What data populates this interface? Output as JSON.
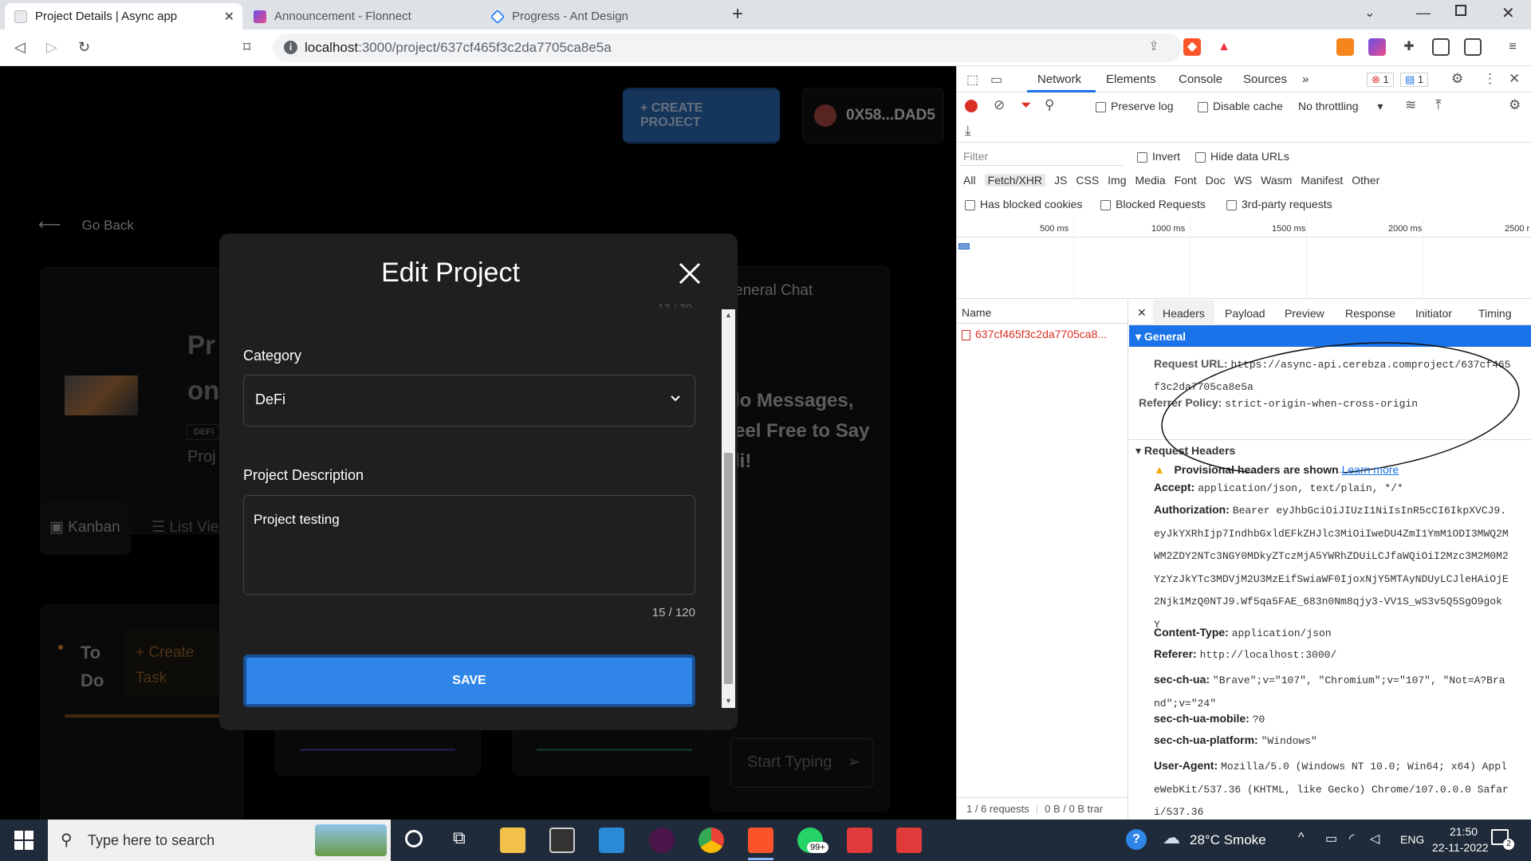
{
  "browser": {
    "tabs": [
      {
        "title": "Project Details | Async app"
      },
      {
        "title": "Announcement - Flonnect"
      },
      {
        "title": "Progress - Ant Design"
      }
    ],
    "url_host": "localhost",
    "url_path": ":3000/project/637cf465f3c2da7705ca8e5a"
  },
  "app": {
    "create_project": "+ CREATE PROJECT",
    "wallet": "0X58...DAD5",
    "go_back": "Go Back",
    "project_title_frag1": "Pr",
    "project_title_frag2": "on",
    "badge": "DEFI",
    "project_frag3": "Proj",
    "general_chat": "eneral Chat",
    "no_messages": "lo Messages,\neel Free to Say\nli!",
    "kanban": "Kanban",
    "list_view": "List Vie",
    "todo": "To\nDo",
    "create_task": "+ Create\nTask",
    "chat_placeholder": "Start Typing"
  },
  "modal": {
    "title": "Edit Project",
    "partial_counter": "13 / 30",
    "category_label": "Category",
    "category_value": "DeFi",
    "description_label": "Project Description",
    "description_value": "Project testing",
    "counter": "15 / 120",
    "save": "SAVE"
  },
  "devtools": {
    "tabs": [
      "Network",
      "Elements",
      "Console",
      "Sources"
    ],
    "error_count": "1",
    "message_count": "1",
    "preserve_log": "Preserve log",
    "disable_cache": "Disable cache",
    "throttling": "No throttling",
    "filter_placeholder": "Filter",
    "invert": "Invert",
    "hide_data_urls": "Hide data URLs",
    "type_filters": [
      "All",
      "Fetch/XHR",
      "JS",
      "CSS",
      "Img",
      "Media",
      "Font",
      "Doc",
      "WS",
      "Wasm",
      "Manifest",
      "Other"
    ],
    "has_blocked_cookies": "Has blocked cookies",
    "blocked_requests": "Blocked Requests",
    "third_party": "3rd-party requests",
    "timeline_ticks": [
      "500 ms",
      "1000 ms",
      "1500 ms",
      "2000 ms",
      "2500 r"
    ],
    "name_header": "Name",
    "request_name": "637cf465f3c2da7705ca8...",
    "detail_tabs": [
      "Headers",
      "Payload",
      "Preview",
      "Response",
      "Initiator",
      "Timing"
    ],
    "general_title": "General",
    "request_url_label": "Request URL:",
    "request_url_value": "https://async-api.cerebza.comproject/637cf465\nf3c2da7705ca8e5a",
    "referrer_policy_label": "Referrer Policy:",
    "referrer_policy_value": "strict-origin-when-cross-origin",
    "request_headers_title": "Request Headers",
    "provisional": "Provisional headers are shown",
    "learn_more": "Learn more",
    "headers": [
      {
        "k": "Accept:",
        "v": "application/json, text/plain, */*"
      },
      {
        "k": "Authorization:",
        "v": "Bearer eyJhbGciOiJIUzI1NiIsInR5cCI6IkpXVCJ9.\neyJkYXRhIjp7IndhbGxldEFkZHJlc3MiOiIweDU4ZmI1YmM1ODI3MWQ2M\nWM2ZDY2NTc3NGY0MDkyZTczMjA5YWRhZDUiLCJfaWQiOiI2Mzc3M2M0M2\nYzYzJkYTc3MDVjM2U3MzEifSwiaWF0IjoxNjY5MTAyNDUyLCJleHAiOjE\n2Njk1MzQ0NTJ9.Wf5qa5FAE_683n0Nm8qjy3-VV1S_wS3v5Q5SgO9gok\nY"
      },
      {
        "k": "Content-Type:",
        "v": "application/json"
      },
      {
        "k": "Referer:",
        "v": "http://localhost:3000/"
      },
      {
        "k": "sec-ch-ua:",
        "v": "\"Brave\";v=\"107\", \"Chromium\";v=\"107\", \"Not=A?Bra\nnd\";v=\"24\""
      },
      {
        "k": "sec-ch-ua-mobile:",
        "v": "?0"
      },
      {
        "k": "sec-ch-ua-platform:",
        "v": "\"Windows\""
      },
      {
        "k": "User-Agent:",
        "v": "Mozilla/5.0 (Windows NT 10.0; Win64; x64) Appl\neWebKit/537.36 (KHTML, like Gecko) Chrome/107.0.0.0 Safar\ni/537.36"
      }
    ],
    "status_requests": "1 / 6 requests",
    "status_transfer": "0 B / 0 B trar"
  },
  "taskbar": {
    "search_placeholder": "Type here to search",
    "whatsapp_badge": "99+",
    "weather": "28°C  Smoke",
    "lang": "ENG",
    "time": "21:50",
    "date": "22-11-2022",
    "notif_count": "2"
  }
}
